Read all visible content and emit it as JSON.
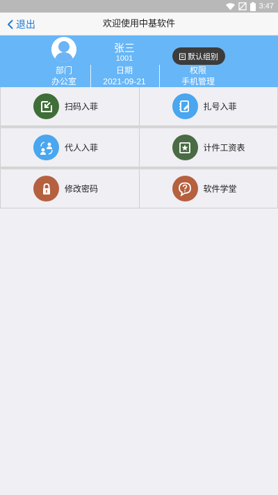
{
  "status": {
    "time": "3:47"
  },
  "nav": {
    "back_label": "退出",
    "title": "欢迎使用中基软件"
  },
  "profile": {
    "name": "张三",
    "id": "1001",
    "dept_label": "部门",
    "dept_value": "办公室",
    "date_label": "日期",
    "date_value": "2021-09-21",
    "perm_label": "权限",
    "perm_value": "手机管理"
  },
  "tooltip": {
    "label": "默认组别"
  },
  "menu": [
    {
      "label": "扫码入菲",
      "icon": "scan-entry-icon",
      "color": "#3f6e38"
    },
    {
      "label": "扎号入菲",
      "icon": "notebook-edit-icon",
      "color": "#49a6ef"
    },
    {
      "label": "代人入菲",
      "icon": "user-swap-icon",
      "color": "#49a6ef"
    },
    {
      "label": "计件工资表",
      "icon": "star-square-icon",
      "color": "#4a6b44"
    },
    {
      "label": "修改密码",
      "icon": "lock-icon",
      "color": "#b5603f"
    },
    {
      "label": "软件学堂",
      "icon": "question-bubble-icon",
      "color": "#b5603f"
    }
  ]
}
